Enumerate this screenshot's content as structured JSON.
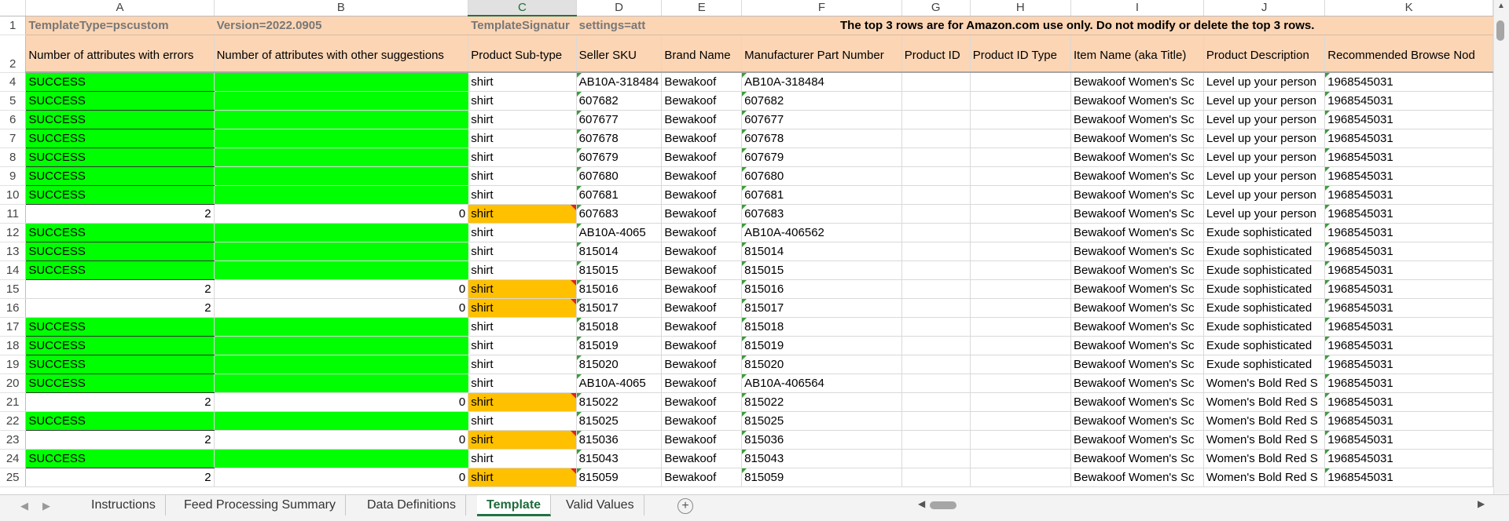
{
  "columns": [
    "A",
    "B",
    "C",
    "D",
    "E",
    "F",
    "G",
    "H",
    "I",
    "J",
    "K"
  ],
  "row1": {
    "num": "1",
    "a": "TemplateType=pscustom",
    "b": "Version=2022.0905",
    "c": "TemplateSignatur",
    "d": "settings=att",
    "notice": "The top 3 rows are for Amazon.com use only. Do not modify or delete the top 3 rows."
  },
  "row2": {
    "num": "2",
    "headers": [
      "Number of attributes with errors",
      "Number of attributes with other suggestions",
      "Product Sub-type",
      "Seller SKU",
      "Brand Name",
      "Manufacturer Part Number",
      "Product ID",
      "Product ID Type",
      "Item Name (aka Title)",
      "Product Description",
      "Recommended Browse Nod"
    ]
  },
  "rows": [
    {
      "num": "4",
      "status": "SUCCESS",
      "subtype": "shirt",
      "sku": "AB10A-318484",
      "brand": "Bewakoof",
      "mpn": "AB10A-318484",
      "title": "Bewakoof Women's Sc",
      "desc": "Level up your person",
      "node": "1968545031"
    },
    {
      "num": "5",
      "status": "SUCCESS",
      "subtype": "shirt",
      "sku": "607682",
      "brand": "Bewakoof",
      "mpn": "607682",
      "title": "Bewakoof Women's Sc",
      "desc": "Level up your person",
      "node": "1968545031"
    },
    {
      "num": "6",
      "status": "SUCCESS",
      "subtype": "shirt",
      "sku": "607677",
      "brand": "Bewakoof",
      "mpn": "607677",
      "title": "Bewakoof Women's Sc",
      "desc": "Level up your person",
      "node": "1968545031"
    },
    {
      "num": "7",
      "status": "SUCCESS",
      "subtype": "shirt",
      "sku": "607678",
      "brand": "Bewakoof",
      "mpn": "607678",
      "title": "Bewakoof Women's Sc",
      "desc": "Level up your person",
      "node": "1968545031"
    },
    {
      "num": "8",
      "status": "SUCCESS",
      "subtype": "shirt",
      "sku": "607679",
      "brand": "Bewakoof",
      "mpn": "607679",
      "title": "Bewakoof Women's Sc",
      "desc": "Level up your person",
      "node": "1968545031"
    },
    {
      "num": "9",
      "status": "SUCCESS",
      "subtype": "shirt",
      "sku": "607680",
      "brand": "Bewakoof",
      "mpn": "607680",
      "title": "Bewakoof Women's Sc",
      "desc": "Level up your person",
      "node": "1968545031"
    },
    {
      "num": "10",
      "status": "SUCCESS",
      "subtype": "shirt",
      "sku": "607681",
      "brand": "Bewakoof",
      "mpn": "607681",
      "title": "Bewakoof Women's Sc",
      "desc": "Level up your person",
      "node": "1968545031"
    },
    {
      "num": "11",
      "errors": "2",
      "suggestions": "0",
      "subtype": "shirt",
      "sku": "607683",
      "brand": "Bewakoof",
      "mpn": "607683",
      "title": "Bewakoof Women's Sc",
      "desc": "Level up your person",
      "node": "1968545031"
    },
    {
      "num": "12",
      "status": "SUCCESS",
      "subtype": "shirt",
      "sku": "AB10A-4065",
      "brand": "Bewakoof",
      "mpn": "AB10A-406562",
      "title": "Bewakoof Women's Sc",
      "desc": "Exude sophisticated",
      "node": "1968545031"
    },
    {
      "num": "13",
      "status": "SUCCESS",
      "subtype": "shirt",
      "sku": "815014",
      "brand": "Bewakoof",
      "mpn": "815014",
      "title": "Bewakoof Women's Sc",
      "desc": "Exude sophisticated",
      "node": "1968545031"
    },
    {
      "num": "14",
      "status": "SUCCESS",
      "subtype": "shirt",
      "sku": "815015",
      "brand": "Bewakoof",
      "mpn": "815015",
      "title": "Bewakoof Women's Sc",
      "desc": "Exude sophisticated",
      "node": "1968545031"
    },
    {
      "num": "15",
      "errors": "2",
      "suggestions": "0",
      "subtype": "shirt",
      "sku": "815016",
      "brand": "Bewakoof",
      "mpn": "815016",
      "title": "Bewakoof Women's Sc",
      "desc": "Exude sophisticated",
      "node": "1968545031"
    },
    {
      "num": "16",
      "errors": "2",
      "suggestions": "0",
      "subtype": "shirt",
      "sku": "815017",
      "brand": "Bewakoof",
      "mpn": "815017",
      "title": "Bewakoof Women's Sc",
      "desc": "Exude sophisticated",
      "node": "1968545031"
    },
    {
      "num": "17",
      "status": "SUCCESS",
      "subtype": "shirt",
      "sku": "815018",
      "brand": "Bewakoof",
      "mpn": "815018",
      "title": "Bewakoof Women's Sc",
      "desc": "Exude sophisticated",
      "node": "1968545031"
    },
    {
      "num": "18",
      "status": "SUCCESS",
      "subtype": "shirt",
      "sku": "815019",
      "brand": "Bewakoof",
      "mpn": "815019",
      "title": "Bewakoof Women's Sc",
      "desc": "Exude sophisticated",
      "node": "1968545031"
    },
    {
      "num": "19",
      "status": "SUCCESS",
      "subtype": "shirt",
      "sku": "815020",
      "brand": "Bewakoof",
      "mpn": "815020",
      "title": "Bewakoof Women's Sc",
      "desc": "Exude sophisticated",
      "node": "1968545031"
    },
    {
      "num": "20",
      "status": "SUCCESS",
      "subtype": "shirt",
      "sku": "AB10A-4065",
      "brand": "Bewakoof",
      "mpn": "AB10A-406564",
      "title": "Bewakoof Women's Sc",
      "desc": "Women's Bold Red S",
      "node": "1968545031"
    },
    {
      "num": "21",
      "errors": "2",
      "suggestions": "0",
      "subtype": "shirt",
      "sku": "815022",
      "brand": "Bewakoof",
      "mpn": "815022",
      "title": "Bewakoof Women's Sc",
      "desc": "Women's Bold Red S",
      "node": "1968545031"
    },
    {
      "num": "22",
      "status": "SUCCESS",
      "subtype": "shirt",
      "sku": "815025",
      "brand": "Bewakoof",
      "mpn": "815025",
      "title": "Bewakoof Women's Sc",
      "desc": "Women's Bold Red S",
      "node": "1968545031"
    },
    {
      "num": "23",
      "errors": "2",
      "suggestions": "0",
      "subtype": "shirt",
      "sku": "815036",
      "brand": "Bewakoof",
      "mpn": "815036",
      "title": "Bewakoof Women's Sc",
      "desc": "Women's Bold Red S",
      "node": "1968545031"
    },
    {
      "num": "24",
      "status": "SUCCESS",
      "subtype": "shirt",
      "sku": "815043",
      "brand": "Bewakoof",
      "mpn": "815043",
      "title": "Bewakoof Women's Sc",
      "desc": "Women's Bold Red S",
      "node": "1968545031"
    },
    {
      "num": "25",
      "errors": "2",
      "suggestions": "0",
      "subtype": "shirt",
      "sku": "815059",
      "brand": "Bewakoof",
      "mpn": "815059",
      "title": "Bewakoof Women's Sc",
      "desc": "Women's Bold Red S",
      "node": "1968545031"
    }
  ],
  "tabs": [
    "Instructions",
    "Feed Processing Summary",
    "Data Definitions",
    "Template",
    "Valid Values"
  ],
  "active_tab": "Template",
  "colors": {
    "success": "#00ff00",
    "warning": "#ffc000",
    "header": "#fcd5b4",
    "accent": "#217346"
  },
  "icons": {
    "add_sheet": "plus-circle-icon",
    "nav_prev": "triangle-left-icon",
    "nav_next": "triangle-right-icon"
  }
}
